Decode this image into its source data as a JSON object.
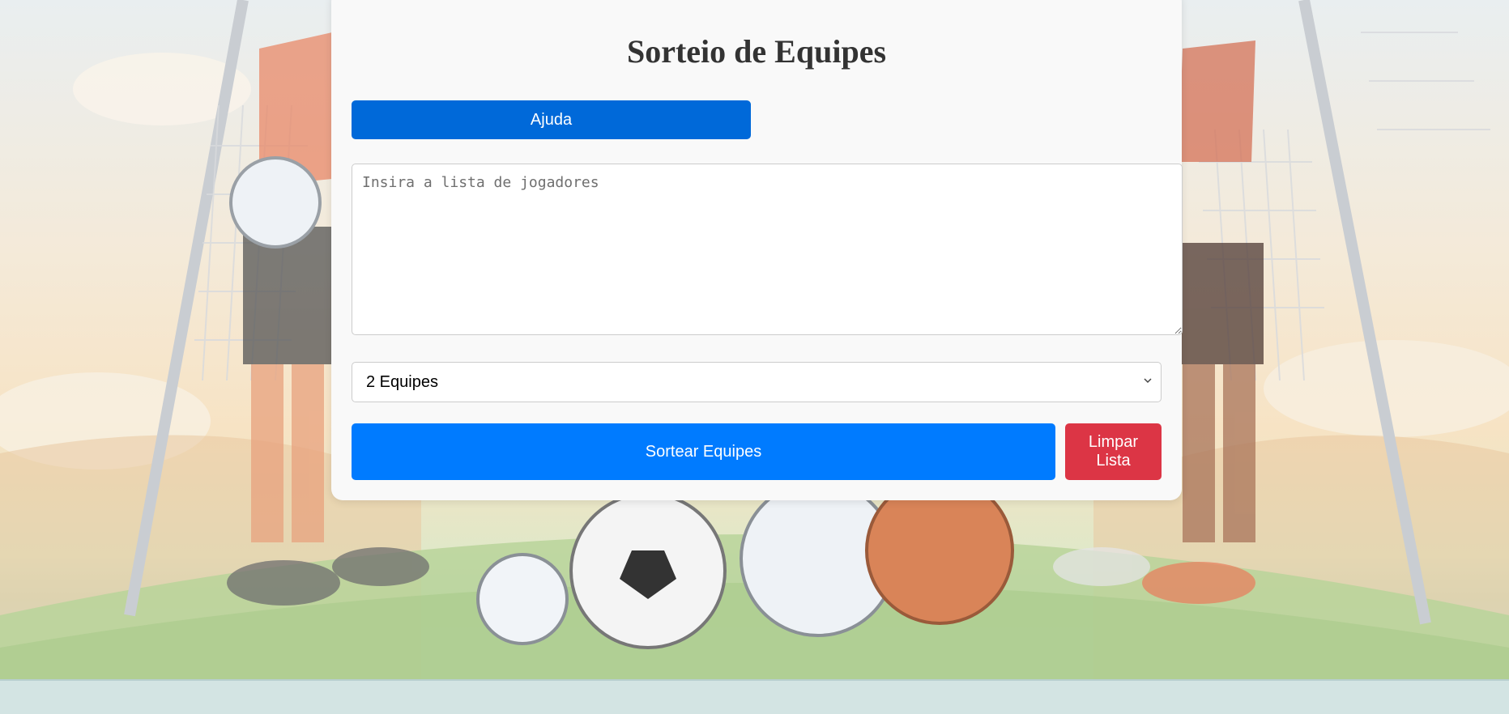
{
  "page": {
    "title": "Sorteio de Equipes"
  },
  "buttons": {
    "help_label": "Ajuda",
    "draw_label": "Sortear Equipes",
    "clear_label": "Limpar Lista"
  },
  "players_input": {
    "placeholder": "Insira a lista de jogadores",
    "value": ""
  },
  "team_select": {
    "selected": "2 Equipes"
  },
  "colors": {
    "help_button": "#0069d9",
    "draw_button": "#007bff",
    "clear_button": "#dc3545",
    "card": "#f9f9f9"
  }
}
